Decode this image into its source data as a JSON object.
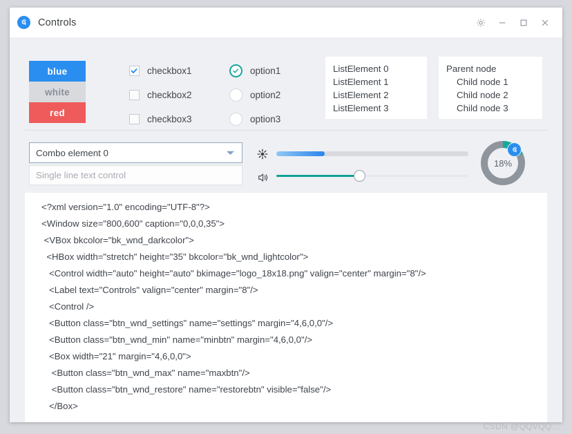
{
  "window": {
    "title": "Controls",
    "logo_icon": "app-logo-icon",
    "buttons": [
      {
        "name": "settings-button",
        "icon": "gear-icon"
      },
      {
        "name": "minimize-button",
        "icon": "minimize-icon"
      },
      {
        "name": "maximize-button",
        "icon": "maximize-icon"
      },
      {
        "name": "close-button",
        "icon": "close-icon"
      }
    ]
  },
  "colors": {
    "blue": "#2a8ef0",
    "white_btn": "#d8dade",
    "red": "#ef5b5b",
    "teal": "#0fa195",
    "panel_bg": "#eff0f4",
    "content_bg": "#ffffff"
  },
  "color_buttons": [
    {
      "label": "blue",
      "variant": "blue"
    },
    {
      "label": "white",
      "variant": "white"
    },
    {
      "label": "red",
      "variant": "red"
    }
  ],
  "checkboxes": [
    {
      "label": "checkbox1",
      "checked": true
    },
    {
      "label": "checkbox2",
      "checked": false
    },
    {
      "label": "checkbox3",
      "checked": false
    }
  ],
  "radios": [
    {
      "label": "option1",
      "selected": true
    },
    {
      "label": "option2",
      "selected": false
    },
    {
      "label": "option3",
      "selected": false
    }
  ],
  "listbox": {
    "items": [
      "ListElement 0",
      "ListElement 1",
      "ListElement 2",
      "ListElement 3"
    ]
  },
  "treeview": {
    "root": "Parent node",
    "children": [
      "Child node 1",
      "Child node 2",
      "Child node 3"
    ]
  },
  "combo": {
    "value": "Combo element 0",
    "arrow_icon": "chevron-down-icon"
  },
  "text_input": {
    "placeholder": "Single line text control",
    "value": ""
  },
  "progress_slider": {
    "icon": "brightness-icon",
    "percent": 25
  },
  "volume_slider": {
    "icon": "volume-icon",
    "percent": 43
  },
  "donut": {
    "label": "18%",
    "percent": 18,
    "badge_icon": "app-logo-icon"
  },
  "xml": {
    "lines": [
      "<?xml version=\"1.0\" encoding=\"UTF-8\"?>",
      "<Window size=\"800,600\" caption=\"0,0,0,35\">",
      " <VBox bkcolor=\"bk_wnd_darkcolor\">",
      "  <HBox width=\"stretch\" height=\"35\" bkcolor=\"bk_wnd_lightcolor\">",
      "   <Control width=\"auto\" height=\"auto\" bkimage=\"logo_18x18.png\" valign=\"center\" margin=\"8\"/>",
      "   <Label text=\"Controls\" valign=\"center\" margin=\"8\"/>",
      "   <Control />",
      "   <Button class=\"btn_wnd_settings\" name=\"settings\" margin=\"4,6,0,0\"/>",
      "   <Button class=\"btn_wnd_min\" name=\"minbtn\" margin=\"4,6,0,0\"/>",
      "   <Box width=\"21\" margin=\"4,6,0,0\">",
      "    <Button class=\"btn_wnd_max\" name=\"maxbtn\"/>",
      "    <Button class=\"btn_wnd_restore\" name=\"restorebtn\" visible=\"false\"/>",
      "   </Box>"
    ]
  },
  "watermark": "CSDN @QQVQQ..."
}
